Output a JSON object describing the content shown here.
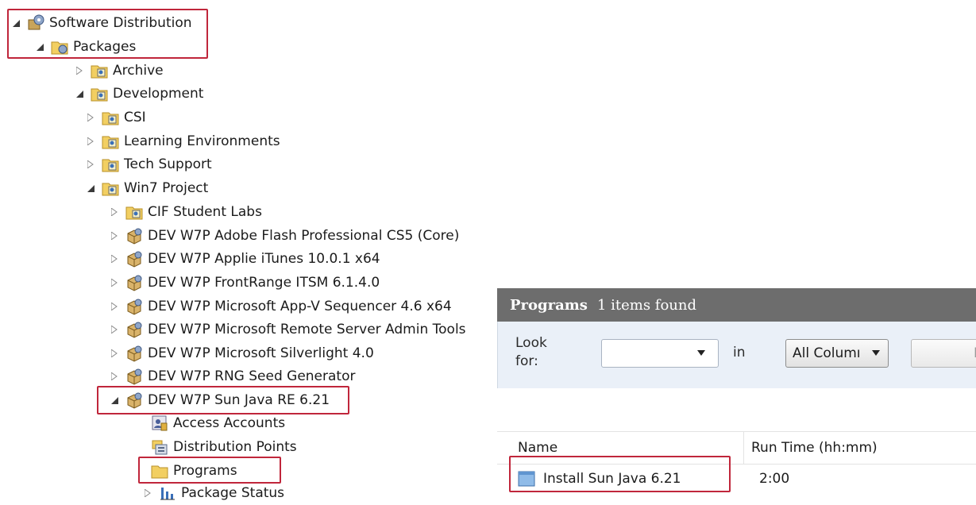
{
  "tree": {
    "root": {
      "label": "Software Distribution"
    },
    "packages": {
      "label": "Packages"
    },
    "archive": {
      "label": "Archive"
    },
    "development": {
      "label": "Development"
    },
    "csi": {
      "label": "CSI"
    },
    "learning": {
      "label": "Learning Environments"
    },
    "techsupport": {
      "label": "Tech Support"
    },
    "win7": {
      "label": "Win7 Project"
    },
    "cif": {
      "label": "CIF Student Labs"
    },
    "flash": {
      "label": "DEV W7P Adobe Flash Professional CS5 (Core)"
    },
    "itunes": {
      "label": "DEV W7P Applie iTunes 10.0.1 x64"
    },
    "frontrange": {
      "label": "DEV W7P FrontRange ITSM 6.1.4.0"
    },
    "appv": {
      "label": "DEV W7P Microsoft App-V Sequencer 4.6 x64"
    },
    "rsat": {
      "label": "DEV W7P Microsoft Remote Server Admin Tools"
    },
    "silverlight": {
      "label": "DEV W7P Microsoft Silverlight 4.0"
    },
    "rng": {
      "label": "DEV W7P RNG Seed Generator"
    },
    "java": {
      "label": "DEV W7P Sun Java RE 6.21"
    },
    "access": {
      "label": "Access Accounts"
    },
    "distpoints": {
      "label": "Distribution Points"
    },
    "programs": {
      "label": "Programs"
    },
    "status": {
      "label": "Package Status"
    }
  },
  "programs_panel": {
    "title": "Programs",
    "count": "1 items found",
    "look_for_label": "Look for:",
    "look_for_value": "",
    "in_label": "in",
    "columns_select": "All Columı",
    "find_button": "F",
    "columns": [
      "Name",
      "Run Time (hh:mm)"
    ],
    "rows": [
      {
        "name": "Install Sun Java 6.21",
        "run_time": "2:00"
      }
    ]
  },
  "colors": {
    "highlight_box": "#c0263b",
    "panel_header_bg": "#6d6d6d",
    "search_bar_bg": "#eaf0f8"
  }
}
